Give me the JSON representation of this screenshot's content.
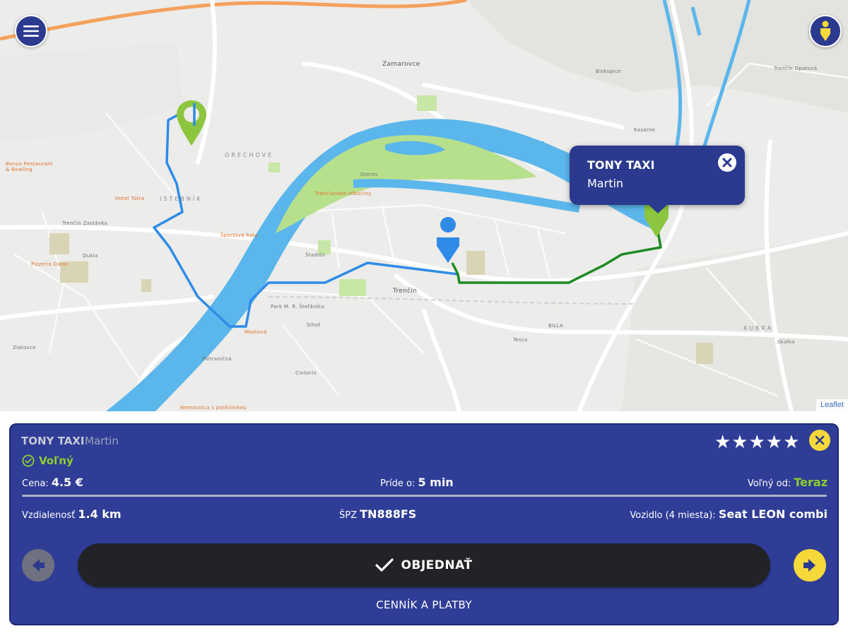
{
  "map": {
    "attribution": "Leaflet",
    "labels": {
      "zamarovce": "Zamarovce",
      "orechove": "ORECHOVÉ",
      "istebnik": "ISTEBNÍK",
      "kubra": "KUBRA",
      "trencin_zastavka": "Trenčín Zastávka",
      "trencin": "Trenčín",
      "trencin_opatova": "Trenčín Opatová",
      "hotel_tatra": "Hotel Tatra",
      "bonus_restaurant": "Bonus Restaurant & Bowling",
      "pizzeria": "Pizzeria Dano",
      "sportova_hala": "Športová hala",
      "trencianske_hlbocine": "Trenčianske Hlbočiny",
      "ostrov": "Ostrov",
      "mostova": "Mostová",
      "stadion": "Štadión",
      "park": "Park M. R. Štefánika",
      "dukla": "Dukla",
      "pohranicna": "Pohraničná",
      "skalka": "Skalka",
      "sihot": "Sihoť",
      "zlatovce": "Zlatovce",
      "nemocnica": "Nemocnica s poliklinikou",
      "cintorin": "Cintorín",
      "tesco": "Tesco",
      "billa": "BILLA",
      "biskupice": "Biskupice",
      "kasarne": "Kasárne"
    }
  },
  "map_popup": {
    "title": "TONY TAXI",
    "subtitle": "Martin"
  },
  "driver_card": {
    "company": "TONY TAXI",
    "driver": "Martin",
    "rating_stars": "★★★★★",
    "rating_value": 5,
    "status": "Voľný",
    "price_label": "Cena:",
    "price_value": "4.5 €",
    "eta_label": "Príde o:",
    "eta_value": "5 min",
    "available_label": "Voľný od:",
    "available_value": "Teraz",
    "distance_label": "Vzdialenosť",
    "distance_value": "1.4 km",
    "plate_label": "ŠPZ",
    "plate_value": "TN888FS",
    "vehicle_label": "Vozidlo (4 miesta):",
    "vehicle_value": "Seat LEON combi"
  },
  "actions": {
    "order_label": "OBJEDNAŤ",
    "prices_link": "CENNÍK A PLATBY"
  },
  "colors": {
    "panel": "#2f3d96",
    "accent_yellow": "#f5d83a",
    "status_green": "#8ecf2e",
    "route_blue": "#2f8be6",
    "route_green": "#1f8a24",
    "river": "#5bb6ec",
    "park": "#b7e08c"
  },
  "icons": {
    "menu": "menu-icon",
    "user_location": "person-pin-icon",
    "close": "close-icon",
    "check": "check-icon",
    "arrow_left": "arrow-left-icon",
    "arrow_right": "arrow-right-icon",
    "status": "check-circle-icon"
  }
}
